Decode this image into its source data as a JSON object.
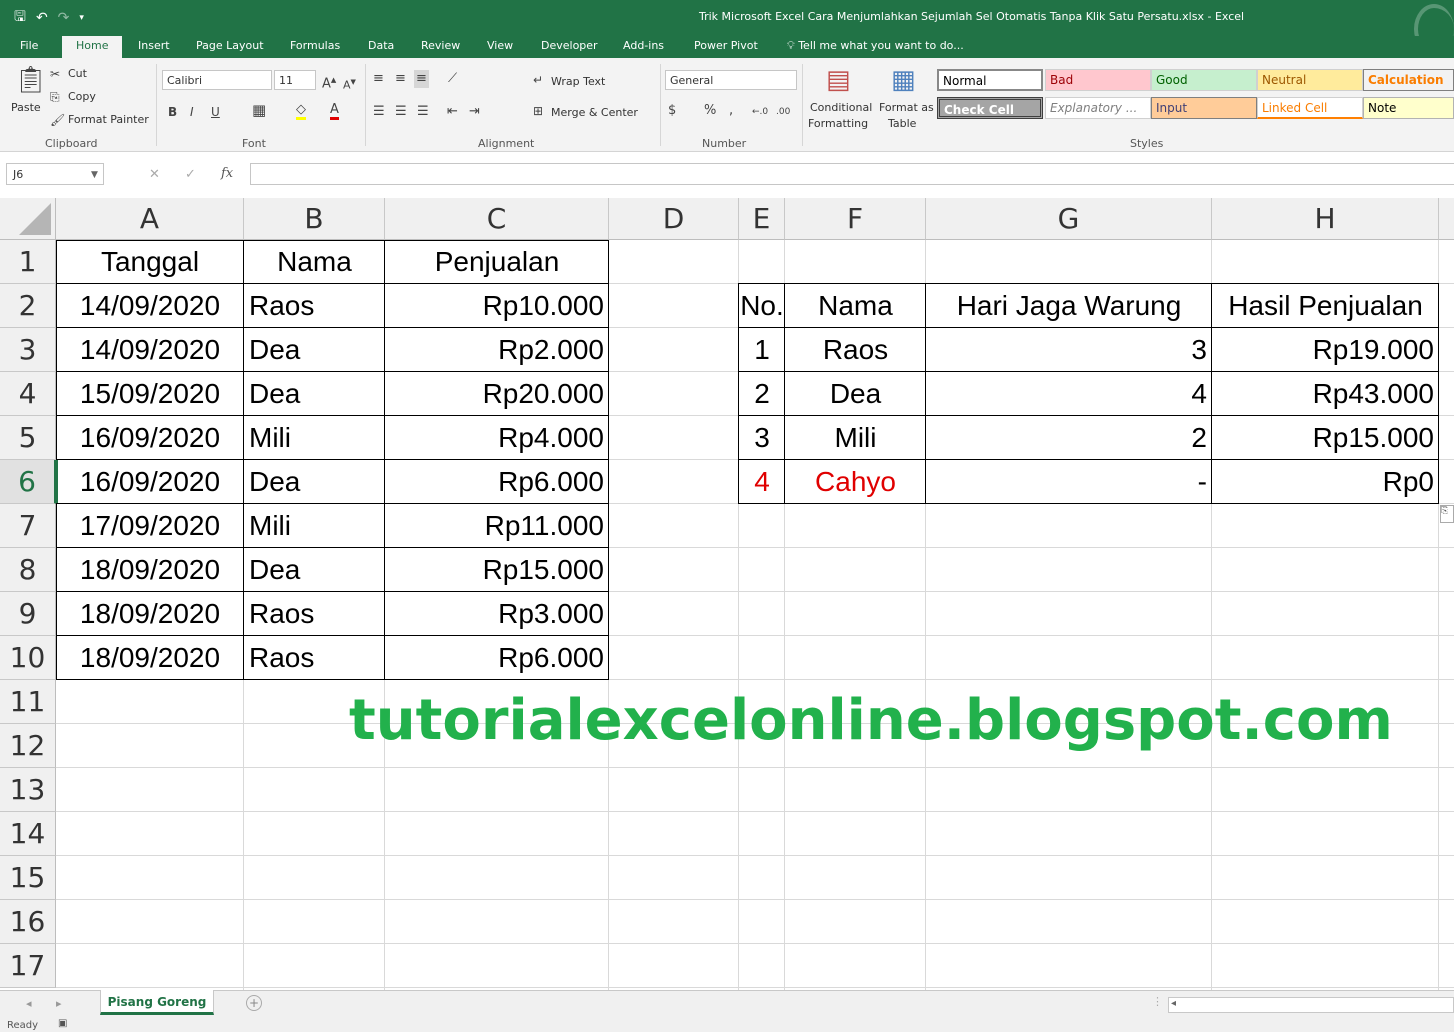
{
  "window": {
    "title": "Trik Microsoft Excel Cara Menjumlahkan Sejumlah Sel Otomatis Tanpa Klik Satu Persatu.xlsx - Excel"
  },
  "ribbon_tabs": [
    "File",
    "Home",
    "Insert",
    "Page Layout",
    "Formulas",
    "Data",
    "Review",
    "View",
    "Developer",
    "Add-ins",
    "Power Pivot"
  ],
  "tell_me": "Tell me what you want to do...",
  "clipboard": {
    "paste": "Paste",
    "cut": "Cut",
    "copy": "Copy",
    "format_painter": "Format Painter",
    "group": "Clipboard"
  },
  "font": {
    "name": "Calibri",
    "size": "11",
    "group": "Font",
    "bold": "B",
    "italic": "I",
    "underline": "U"
  },
  "alignment": {
    "wrap_text": "Wrap Text",
    "merge_center": "Merge & Center",
    "group": "Alignment"
  },
  "number": {
    "format": "General",
    "percent": "%",
    "comma": ",",
    "group": "Number"
  },
  "styles_group": {
    "conditional_formatting_1": "Conditional",
    "conditional_formatting_2": "Formatting",
    "format_as_table_1": "Format as",
    "format_as_table_2": "Table",
    "group": "Styles",
    "cells": {
      "normal": "Normal",
      "bad": "Bad",
      "good": "Good",
      "neutral": "Neutral",
      "calculation": "Calculation",
      "check_cell": "Check Cell",
      "explanatory": "Explanatory ...",
      "input": "Input",
      "linked_cell": "Linked Cell",
      "note": "Note"
    }
  },
  "formula_bar": {
    "name_box": "J6",
    "cancel": "✕",
    "enter": "✓",
    "fx": "fx",
    "value": ""
  },
  "columns": [
    "A",
    "B",
    "C",
    "D",
    "E",
    "F",
    "G",
    "H"
  ],
  "rows": [
    "1",
    "2",
    "3",
    "4",
    "5",
    "6",
    "7",
    "8",
    "9",
    "10",
    "11",
    "12",
    "13",
    "14",
    "15",
    "16",
    "17"
  ],
  "sales_table": {
    "headers": [
      "Tanggal",
      "Nama",
      "Penjualan"
    ],
    "rows": [
      [
        "14/09/2020",
        "Raos",
        "Rp10.000"
      ],
      [
        "14/09/2020",
        "Dea",
        "Rp2.000"
      ],
      [
        "15/09/2020",
        "Dea",
        "Rp20.000"
      ],
      [
        "16/09/2020",
        "Mili",
        "Rp4.000"
      ],
      [
        "16/09/2020",
        "Dea",
        "Rp6.000"
      ],
      [
        "17/09/2020",
        "Mili",
        "Rp11.000"
      ],
      [
        "18/09/2020",
        "Dea",
        "Rp15.000"
      ],
      [
        "18/09/2020",
        "Raos",
        "Rp3.000"
      ],
      [
        "18/09/2020",
        "Raos",
        "Rp6.000"
      ]
    ]
  },
  "summary_table": {
    "headers": [
      "No.",
      "Nama",
      "Hari Jaga Warung",
      "Hasil Penjualan"
    ],
    "rows": [
      [
        "1",
        "Raos",
        "3",
        "Rp19.000"
      ],
      [
        "2",
        "Dea",
        "4",
        "Rp43.000"
      ],
      [
        "3",
        "Mili",
        "2",
        "Rp15.000"
      ],
      [
        "4",
        "Cahyo",
        "-",
        "Rp0"
      ]
    ],
    "highlight_color": "#e00000"
  },
  "watermark": "tutorialexcelonline.blogspot.com",
  "sheet_tab": "Pisang Goreng",
  "status": "Ready",
  "colors": {
    "excel_green": "#217346",
    "watermark_green": "#22b14c"
  }
}
